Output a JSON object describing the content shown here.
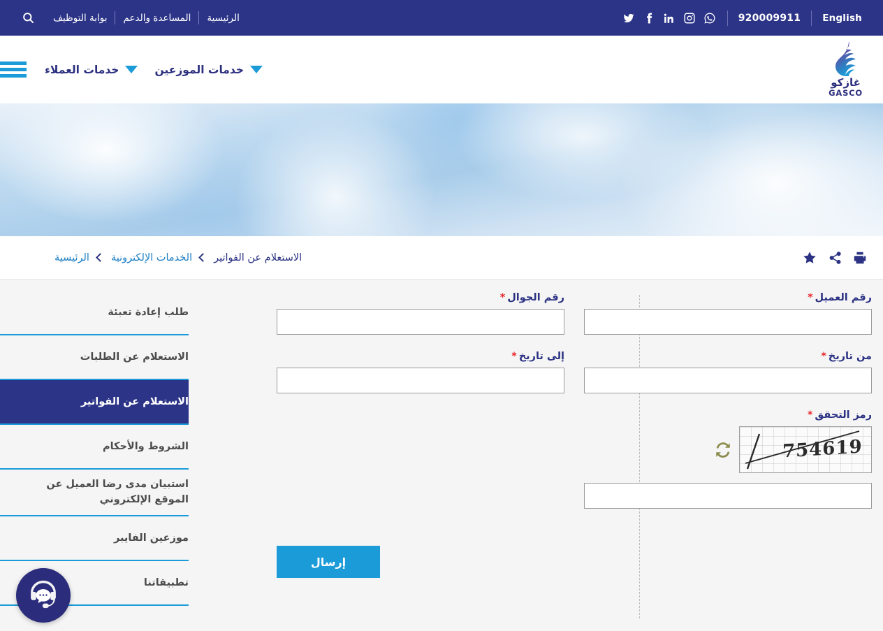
{
  "topbar": {
    "language_label": "English",
    "phone": "920009911",
    "socials": [
      {
        "name": "whatsapp-icon"
      },
      {
        "name": "instagram-icon"
      },
      {
        "name": "linkedin-icon"
      },
      {
        "name": "facebook-icon"
      },
      {
        "name": "twitter-icon"
      }
    ],
    "links": [
      {
        "label": "الرئيسية"
      },
      {
        "label": "المساعدة والدعم"
      },
      {
        "label": "بوابة التوظيف"
      }
    ],
    "search_icon": "search-icon",
    "background_color": "#2c3488"
  },
  "header": {
    "logo": {
      "arabic": "غازكو",
      "english": "GASCO"
    },
    "nav": [
      {
        "label": "خدمات الموزعين"
      },
      {
        "label": "خدمات العملاء"
      }
    ],
    "menu_icon": "hamburger-icon",
    "accent_color": "#1b9bd8"
  },
  "breadcrumb": {
    "items": [
      {
        "label": "الرئيسية",
        "current": false
      },
      {
        "label": "الخدمات الإلكترونية",
        "current": false
      },
      {
        "label": "الاستعلام عن الفواتير",
        "current": true
      }
    ],
    "tools": [
      {
        "name": "print-icon"
      },
      {
        "name": "share-icon"
      },
      {
        "name": "favorite-star-icon"
      }
    ],
    "link_color": "#1f7fc4",
    "current_color": "#2b3283"
  },
  "sidebar": {
    "items": [
      {
        "label": "طلب إعادة تعبئة",
        "active": false
      },
      {
        "label": "الاستعلام عن الطلبات",
        "active": false
      },
      {
        "label": "الاستعلام عن الفواتير",
        "active": true
      },
      {
        "label": "الشروط والأحكام",
        "active": false
      },
      {
        "label": "استبيان مدى رضا العميل عن الموقع الإلكتروني",
        "active": false
      },
      {
        "label": "موزعين الفايبر",
        "active": false
      },
      {
        "label": "تطبيقاتنا",
        "active": false
      }
    ],
    "active_background": "#2c3488",
    "divider_color": "#1b9bd8"
  },
  "form": {
    "required_marker": "*",
    "fields": {
      "customer_number": {
        "label": "رقم العميل",
        "value": "",
        "placeholder": ""
      },
      "mobile_number": {
        "label": "رقم الجوال",
        "value": "",
        "placeholder": ""
      },
      "date_from": {
        "label": "من تاريخ",
        "value": "",
        "placeholder": ""
      },
      "date_to": {
        "label": "إلى تاريخ",
        "value": "",
        "placeholder": ""
      },
      "captcha": {
        "label": "رمز التحقق",
        "value": "",
        "placeholder": "",
        "image_text": "754619",
        "refresh_icon": "refresh-icon"
      }
    },
    "submit_label": "إرسال",
    "submit_color": "#1b9bd8"
  },
  "chat_widget": {
    "icon": "headset-chat-icon",
    "color": "#2b2c7c"
  }
}
